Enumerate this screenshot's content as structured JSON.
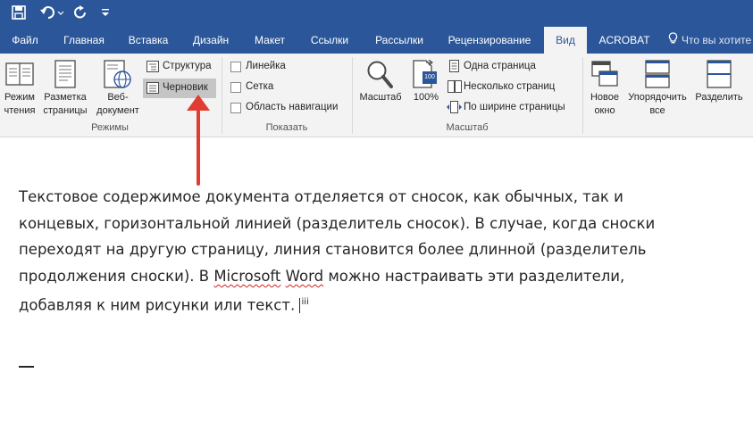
{
  "qat": {
    "save_icon": "save-icon",
    "undo_icon": "undo-icon",
    "redo_icon": "redo-icon",
    "customize_icon": "customize-qat-icon"
  },
  "tabs": [
    {
      "label": "Файл"
    },
    {
      "label": "Главная"
    },
    {
      "label": "Вставка"
    },
    {
      "label": "Дизайн"
    },
    {
      "label": "Макет"
    },
    {
      "label": "Ссылки"
    },
    {
      "label": "Рассылки"
    },
    {
      "label": "Рецензирование"
    },
    {
      "label": "Вид",
      "active": true
    },
    {
      "label": "ACROBAT"
    }
  ],
  "tell_me": "Что вы хотите",
  "ribbon": {
    "views": {
      "read_mode_1": "Режим",
      "read_mode_2": "чтения",
      "print_layout_1": "Разметка",
      "print_layout_2": "страницы",
      "web_layout_1": "Веб-",
      "web_layout_2": "документ",
      "outline": "Структура",
      "draft": "Черновик",
      "group_label": "Режимы"
    },
    "show": {
      "ruler": "Линейка",
      "gridlines": "Сетка",
      "nav_pane": "Область навигации",
      "group_label": "Показать"
    },
    "zoom": {
      "zoom": "Масштаб",
      "hundred_icon_text": "100",
      "hundred": "100%",
      "one_page": "Одна страница",
      "multiple_pages": "Несколько страниц",
      "page_width": "По ширине страницы",
      "group_label": "Масштаб"
    },
    "window": {
      "new_window_1": "Новое",
      "new_window_2": "окно",
      "arrange_all_1": "Упорядочить",
      "arrange_all_2": "все",
      "split": "Разделить"
    }
  },
  "document": {
    "text_before": "Текстовое содержимое документа отделяется от сносок, как обычных, так и концевых, горизонтальной линией (разделитель сносок). В случае, когда сноски переходят на другую страницу, линия становится более длинной (разделитель продолжения сноски). В ",
    "text_ms": "Microsoft",
    "text_space": " ",
    "text_word": "Word",
    "text_after": " можно настраивать эти разделители, добавляя к ним рисунки или текст. ",
    "footnote_ref": "iii"
  },
  "colors": {
    "title_bar": "#2b579a",
    "ribbon_bg": "#f3f3f3",
    "arrow": "#e03c31",
    "selected_button": "#c5c5c5"
  }
}
